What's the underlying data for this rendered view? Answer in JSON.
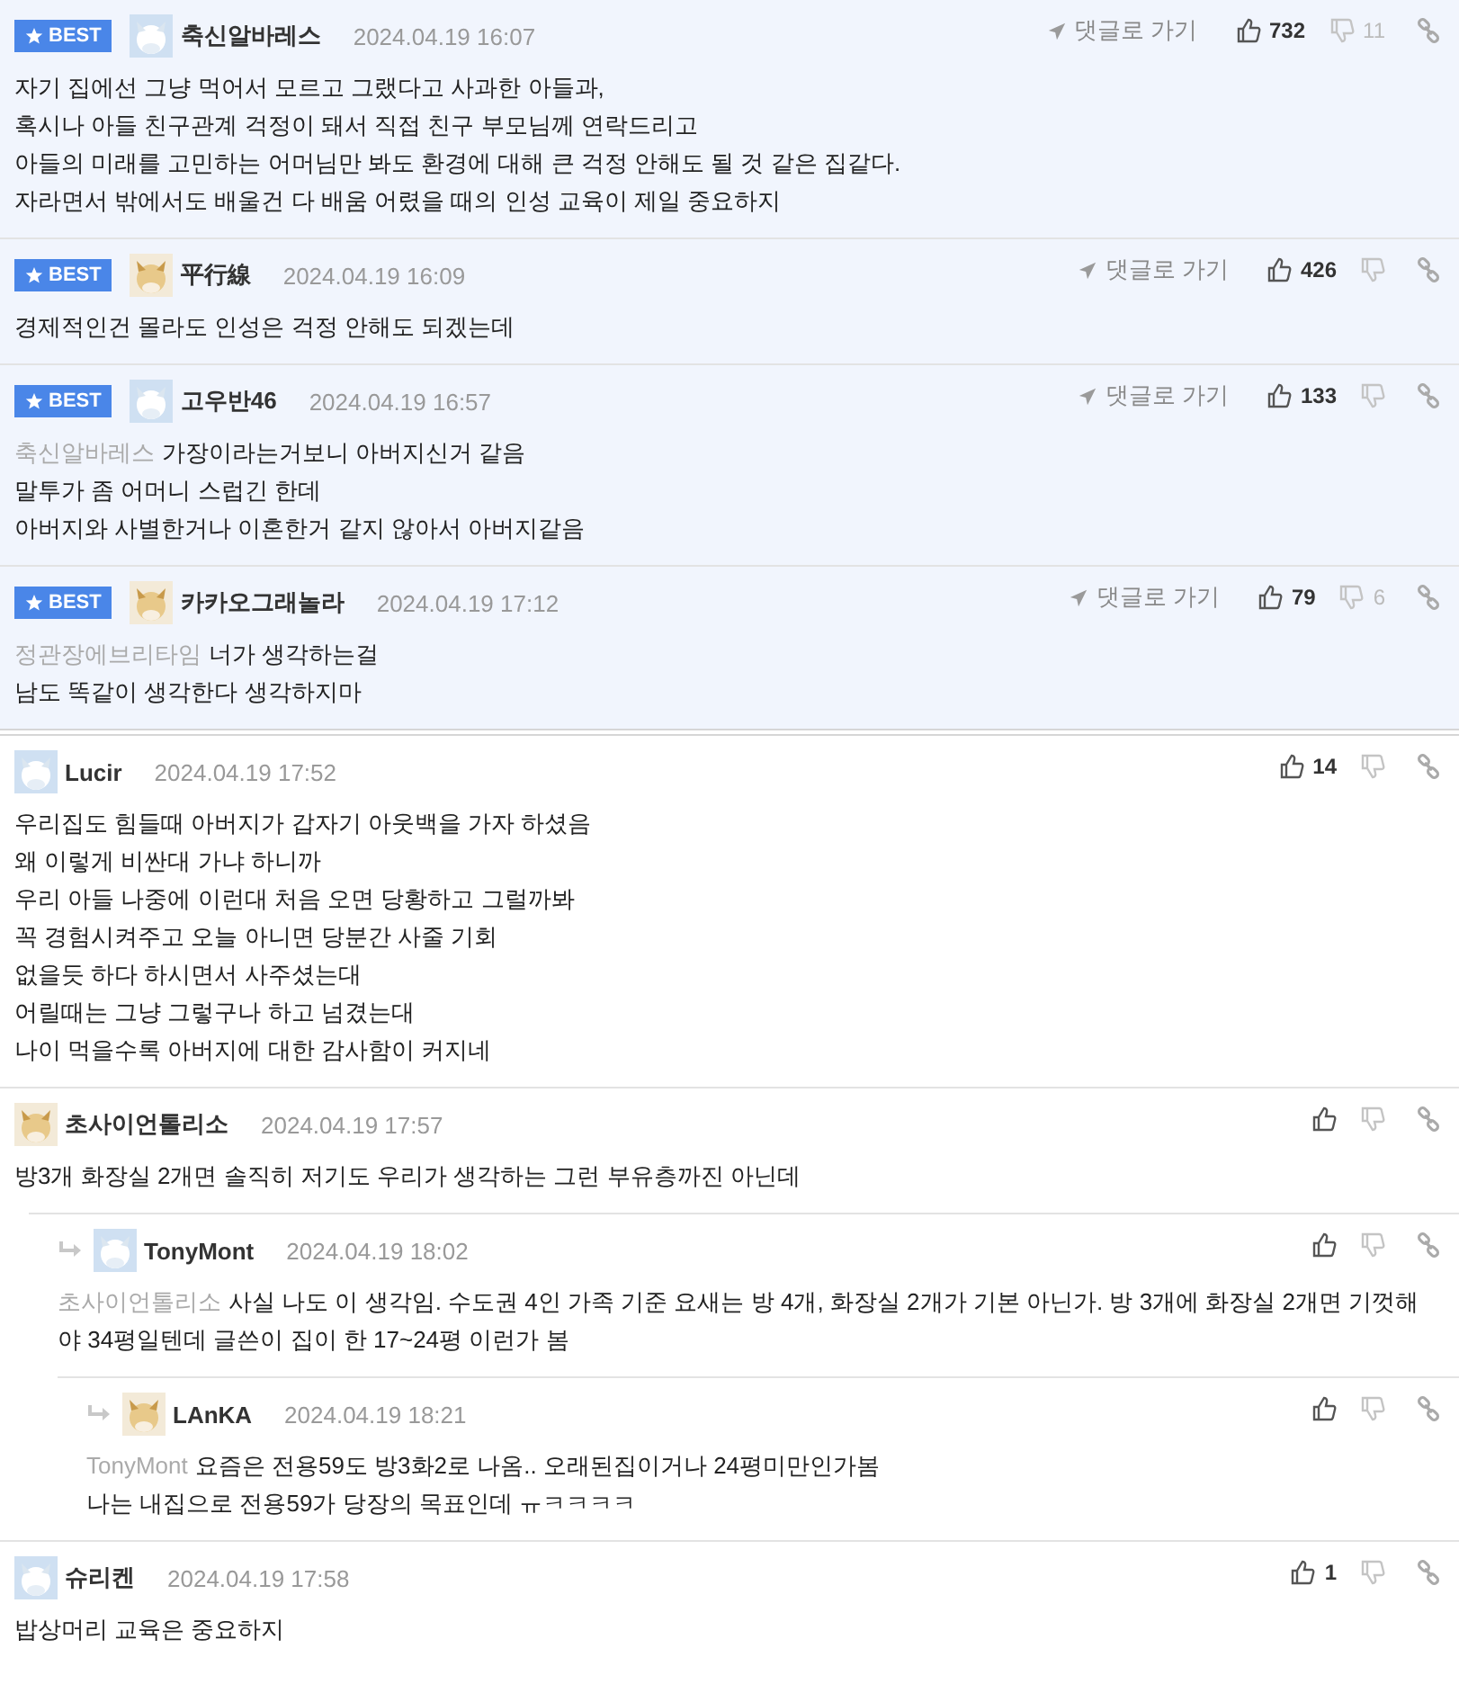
{
  "comments": [
    {
      "best": true,
      "badge": "BEST",
      "author": "축신알바레스",
      "time": "2024.04.19 16:07",
      "goto": "댓글로 가기",
      "likes": "732",
      "dislikes": "11",
      "lines": [
        "자기 집에선 그냥 먹어서 모르고 그랬다고 사과한 아들과,",
        "혹시나 아들 친구관계 걱정이 돼서 직접 친구 부모님께 연락드리고",
        "아들의 미래를 고민하는 어머님만 봐도 환경에 대해 큰 걱정 안해도 될 것 같은 집같다.",
        "자라면서 밖에서도 배울건 다 배움 어렸을 때의 인성 교육이 제일 중요하지"
      ]
    },
    {
      "best": true,
      "badge": "BEST",
      "author": "平行線",
      "time": "2024.04.19 16:09",
      "goto": "댓글로 가기",
      "likes": "426",
      "lines": [
        "경제적인건 몰라도 인성은 걱정 안해도 되겠는데"
      ]
    },
    {
      "best": true,
      "badge": "BEST",
      "author": "고우반46",
      "time": "2024.04.19 16:57",
      "goto": "댓글로 가기",
      "likes": "133",
      "mention": "축신알바레스",
      "lines": [
        "가장이라는거보니 아버지신거 같음",
        "말투가 좀 어머니 스럽긴 한데",
        "아버지와 사별한거나 이혼한거 같지 않아서 아버지같음"
      ]
    },
    {
      "best": true,
      "badge": "BEST",
      "author": "카카오그래놀라",
      "time": "2024.04.19 17:12",
      "goto": "댓글로 가기",
      "likes": "79",
      "dislikes": "6",
      "mention": "정관장에브리타임",
      "lines": [
        "너가 생각하는걸",
        "남도 똑같이 생각한다 생각하지마"
      ]
    },
    {
      "best": false,
      "author": "Lucir",
      "time": "2024.04.19 17:52",
      "likes": "14",
      "lines": [
        "우리집도 힘들때 아버지가 갑자기 아웃백을 가자 하셨음",
        "왜 이렇게 비싼대 가냐 하니까",
        "우리 아들 나중에 이런대 처음 오면 당황하고 그럴까봐",
        "꼭 경험시켜주고 오늘 아니면 당분간 사줄 기회",
        "없을듯 하다 하시면서 사주셨는대",
        "어릴때는 그냥 그렇구나 하고 넘겼는대",
        "나이 먹을수록 아버지에 대한 감사함이 커지네"
      ]
    },
    {
      "best": false,
      "author": "초사이언톨리소",
      "time": "2024.04.19 17:57",
      "lines": [
        "방3개 화장실 2개면 솔직히 저기도 우리가 생각하는 그런 부유층까진 아닌데"
      ],
      "children": [
        {
          "best": false,
          "author": "TonyMont",
          "time": "2024.04.19 18:02",
          "mention": "초사이언톨리소",
          "lines": [
            "사실 나도 이 생각임. 수도권 4인 가족 기준 요새는 방 4개, 화장실 2개가 기본 아닌가. 방 3개에 화장실 2개면 기껏해야 34평일텐데 글쓴이 집이 한 17~24평 이런가 봄"
          ],
          "children": [
            {
              "best": false,
              "author": "LAnKA",
              "time": "2024.04.19 18:21",
              "mention": "TonyMont",
              "lines": [
                "요즘은 전용59도 방3화2로 나옴.. 오래된집이거나 24평미만인가봄",
                "나는 내집으로 전용59가 당장의 목표인데 ㅠㅋㅋㅋㅋ"
              ]
            }
          ]
        }
      ]
    },
    {
      "best": false,
      "author": "슈리켄",
      "time": "2024.04.19 17:58",
      "likes": "1",
      "lines": [
        "밥상머리 교육은 중요하지"
      ]
    }
  ]
}
